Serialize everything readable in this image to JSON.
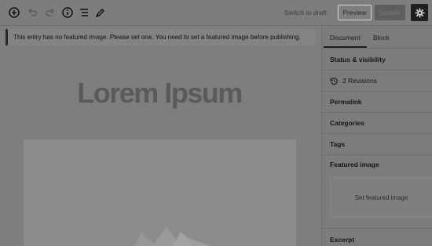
{
  "toolbar": {
    "icons": [
      "add-block-icon",
      "undo-icon",
      "redo-icon",
      "info-icon",
      "outline-icon",
      "pencil-icon",
      "gear-icon"
    ],
    "switch_to_draft": "Switch to draft",
    "preview": "Preview",
    "update": "Update"
  },
  "notice": {
    "text": "This entry has no featured image. Please set one. You need to set a featured image before publishing."
  },
  "post": {
    "title": "Lorem Ipsum"
  },
  "sidebar": {
    "tabs": [
      "Document",
      "Block"
    ],
    "active_tab": "Document",
    "status_visibility": "Status & visibility",
    "revisions": "2 Revisions",
    "permalink": "Permalink",
    "categories": "Categories",
    "tags": "Tags",
    "featured_image": "Featured image",
    "set_featured_image": "Set featured image",
    "excerpt": "Excerpt"
  },
  "colors": {
    "overlay_gray": "#7e7e7e",
    "settings_button_bg": "#1f1f1f",
    "text_dark": "#1a1a1a"
  }
}
